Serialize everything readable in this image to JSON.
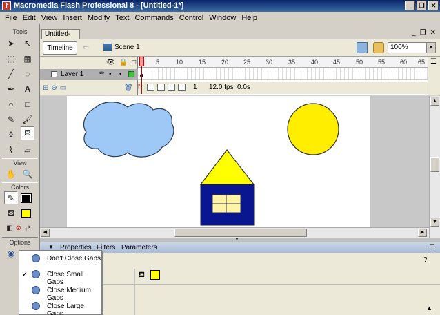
{
  "window": {
    "title": "Macromedia Flash Professional 8 - [Untitled-1*]"
  },
  "menu": [
    "File",
    "Edit",
    "View",
    "Insert",
    "Modify",
    "Text",
    "Commands",
    "Control",
    "Window",
    "Help"
  ],
  "toolbox": {
    "headers": {
      "tools": "Tools",
      "view": "View",
      "colors": "Colors",
      "options": "Options"
    }
  },
  "document": {
    "tab": "Untitled-1*",
    "timeline_button": "Timeline",
    "scene": "Scene 1",
    "zoom": "100%"
  },
  "timeline": {
    "layer_name": "Layer 1",
    "frame_labels": [
      "1",
      "5",
      "10",
      "15",
      "20",
      "25",
      "30",
      "35",
      "40",
      "45",
      "50",
      "55",
      "60",
      "65"
    ],
    "current_frame": "1",
    "fps": "12.0 fps",
    "elapsed": "0.0s"
  },
  "properties": {
    "tabs": [
      "Properties",
      "Filters",
      "Parameters"
    ]
  },
  "gap_menu": {
    "items": [
      {
        "label": "Don't Close Gaps",
        "checked": false
      },
      {
        "label": "Close Small Gaps",
        "checked": true
      },
      {
        "label": "Close Medium Gaps",
        "checked": false
      },
      {
        "label": "Close Large Gaps",
        "checked": false
      }
    ]
  },
  "colors": {
    "fill": "#ffff00",
    "cloud": "#9ec8f5",
    "sun": "#ffee00",
    "roof": "#ffff00",
    "house": "#0a1590",
    "window": "#fff3a8"
  }
}
